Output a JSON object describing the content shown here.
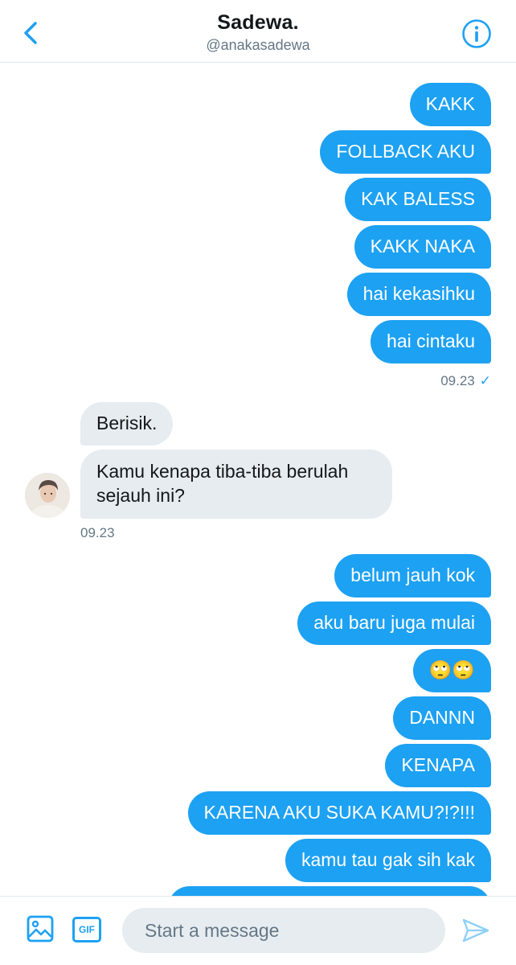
{
  "header": {
    "title": "Sadewa.",
    "handle": "@anakasadewa",
    "icons": {
      "back": "chevron-left-icon",
      "info": "info-circle-icon"
    }
  },
  "messages": {
    "sent_group_1": [
      "KAKK",
      "FOLLBACK AKU",
      "KAK BALESS",
      "KAKK NAKA",
      "hai kekasihku",
      "hai cintaku"
    ],
    "sent_group_1_time": "09.23",
    "sent_group_1_status": "✓",
    "received": [
      "Berisik.",
      "Kamu kenapa tiba-tiba berulah sejauh ini?"
    ],
    "received_time": "09.23",
    "sent_group_2": [
      "belum jauh kok",
      "aku baru juga mulai",
      "🙄🙄",
      "DANNN",
      "KENAPA",
      "KARENA AKU SUKA KAMU?!?!!!",
      "kamu tau gak sih kak"
    ]
  },
  "composer": {
    "placeholder": "Start a message",
    "media_icon": "image-icon",
    "gif_label": "GIF",
    "send_icon": "send-icon"
  },
  "colors": {
    "accent": "#1da1f2",
    "received_bubble": "#e6ecf0",
    "muted_text": "#657786"
  }
}
